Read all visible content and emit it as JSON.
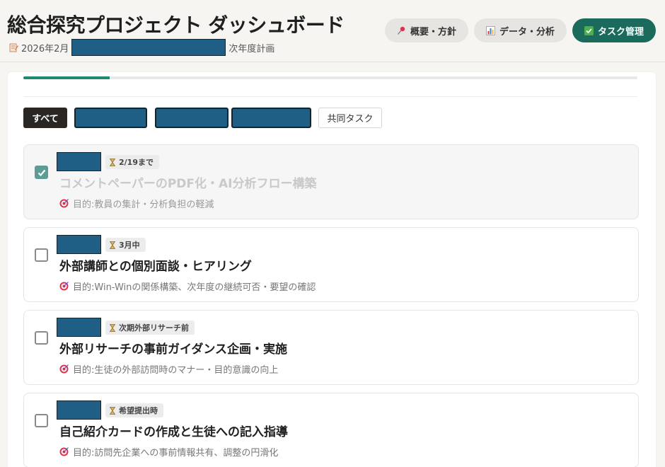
{
  "header": {
    "title": "総合探究プロジェクト ダッシュボード",
    "subtitle_prefix": "2026年2月",
    "subtitle_suffix": "次年度計画"
  },
  "nav": {
    "overview": "概要・方針",
    "data": "データ・分析",
    "tasks": "タスク管理"
  },
  "progress": {
    "fraction": 0.14
  },
  "filters": {
    "all": "すべて",
    "shared": "共同タスク"
  },
  "purpose_prefix": "目的: ",
  "tasks": [
    {
      "deadline": "2/19まで",
      "title": "コメントペーパーのPDF化・AI分析フロー構築",
      "purpose": "教員の集計・分析負担の軽減",
      "done": true
    },
    {
      "deadline": "3月中",
      "title": "外部講師との個別面談・ヒアリング",
      "purpose": "Win-Winの関係構築、次年度の継続可否・要望の確認",
      "done": false
    },
    {
      "deadline": "次期外部リサーチ前",
      "title": "外部リサーチの事前ガイダンス企画・実施",
      "purpose": "生徒の外部訪問時のマナー・目的意識の向上",
      "done": false
    },
    {
      "deadline": "希望提出時",
      "title": "自己紹介カードの作成と生徒への記入指導",
      "purpose": "訪問先企業への事前情報共有、調整の円滑化",
      "done": false
    }
  ],
  "colors": {
    "accent": "#1a6b5c",
    "checked": "#5c9c95",
    "redaction": "#1f5f86"
  },
  "icons": {
    "subtitle": "memo-icon",
    "overview": "pushpin-icon",
    "data": "bar-chart-icon",
    "tasks": "checkmark-icon",
    "deadline": "hourglass-icon",
    "purpose": "target-icon"
  }
}
